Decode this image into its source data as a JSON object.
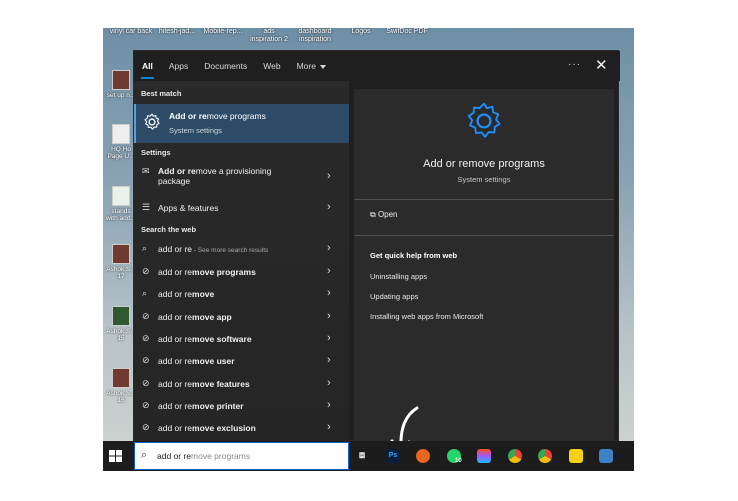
{
  "desktop": {
    "top_icons": [
      "vinyl car back",
      "hitesh-jad...",
      "Mobile-rep...",
      "ads inspiration 2",
      "dashboard inspiration",
      "Logos",
      "SwifDoc PDF"
    ],
    "side_icons": [
      "set up n...",
      "HQ Ho Page U...",
      "stands with add...",
      "Ashok S... 17",
      "Ashok S... 15",
      "Ashok S... 16"
    ]
  },
  "tabs": [
    {
      "label": "All"
    },
    {
      "label": "Apps"
    },
    {
      "label": "Documents"
    },
    {
      "label": "Web"
    },
    {
      "label": "More"
    }
  ],
  "header": {
    "dots": "···",
    "close": "✕"
  },
  "sections": {
    "best_match": "Best match",
    "settings": "Settings",
    "search_web": "Search the web"
  },
  "best_match": {
    "prefix": "Add or re",
    "rest": "move programs",
    "subtitle": "System settings"
  },
  "settings_items": [
    {
      "prefix": "Add or re",
      "rest": "move a provisioning",
      "line2": "package"
    },
    {
      "label": "Apps & features"
    }
  ],
  "web_items": [
    {
      "prefix": "add or re",
      "rest": "",
      "sub": " - See more search results"
    },
    {
      "prefix": "add or re",
      "rest": "move programs"
    },
    {
      "prefix": "add or re",
      "rest": "move"
    },
    {
      "prefix": "add or re",
      "rest": "move app"
    },
    {
      "prefix": "add or re",
      "rest": "move software"
    },
    {
      "prefix": "add or re",
      "rest": "move user"
    },
    {
      "prefix": "add or re",
      "rest": "move features"
    },
    {
      "prefix": "add or re",
      "rest": "move printer"
    },
    {
      "prefix": "add or re",
      "rest": "move exclusion"
    }
  ],
  "preview": {
    "title": "Add or remove programs",
    "subtitle": "System settings",
    "open_label": "Open",
    "help_title": "Get quick help from web",
    "links": [
      "Uninstalling apps",
      "Updating apps",
      "Installing web apps from Microsoft"
    ]
  },
  "taskbar": {
    "search_typed": "add or re",
    "search_ghost": "move programs",
    "whatsapp_badge": "10",
    "ps_label": "Ps"
  },
  "colors": {
    "accent": "#0a84d6",
    "highlight": "#2d4a66",
    "panel": "#1f1f1f"
  }
}
